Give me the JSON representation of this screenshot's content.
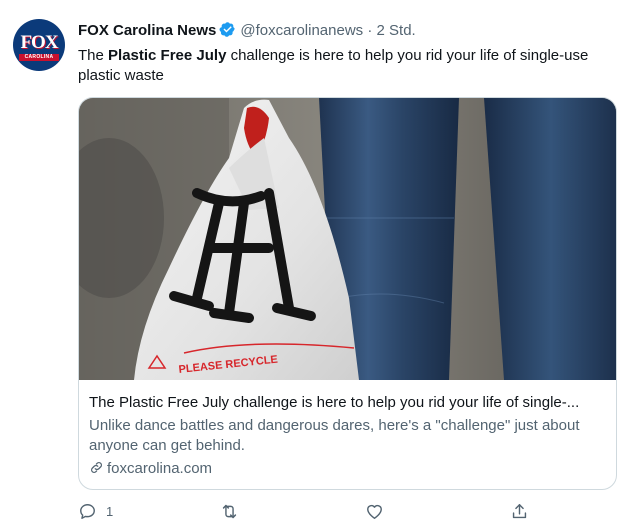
{
  "account": {
    "avatar_text": "FOX",
    "avatar_subtext": "CAROLINA",
    "name": "FOX Carolina News",
    "handle": "@foxcarolinanews",
    "separator": "·",
    "time": "2 Std."
  },
  "tweet": {
    "text_before": "The ",
    "text_bold": "Plastic Free July",
    "text_after": " challenge is here to help you rid your life of single-use plastic waste"
  },
  "card": {
    "image_alt": "Plastic bag held next to jeans",
    "title": "The Plastic Free July challenge is here to help you rid your life of single-...",
    "description": "Unlike dance battles and dangerous dares, here's a \"challenge\" just about anyone can get behind.",
    "domain": "foxcarolina.com",
    "bag_print": "PLEASE RECYCLE"
  },
  "actions": {
    "reply_count": "1",
    "retweet_count": "",
    "like_count": ""
  },
  "colors": {
    "accent": "#1d9bf0",
    "secondary_text": "#536471",
    "border": "#cfd9de"
  }
}
